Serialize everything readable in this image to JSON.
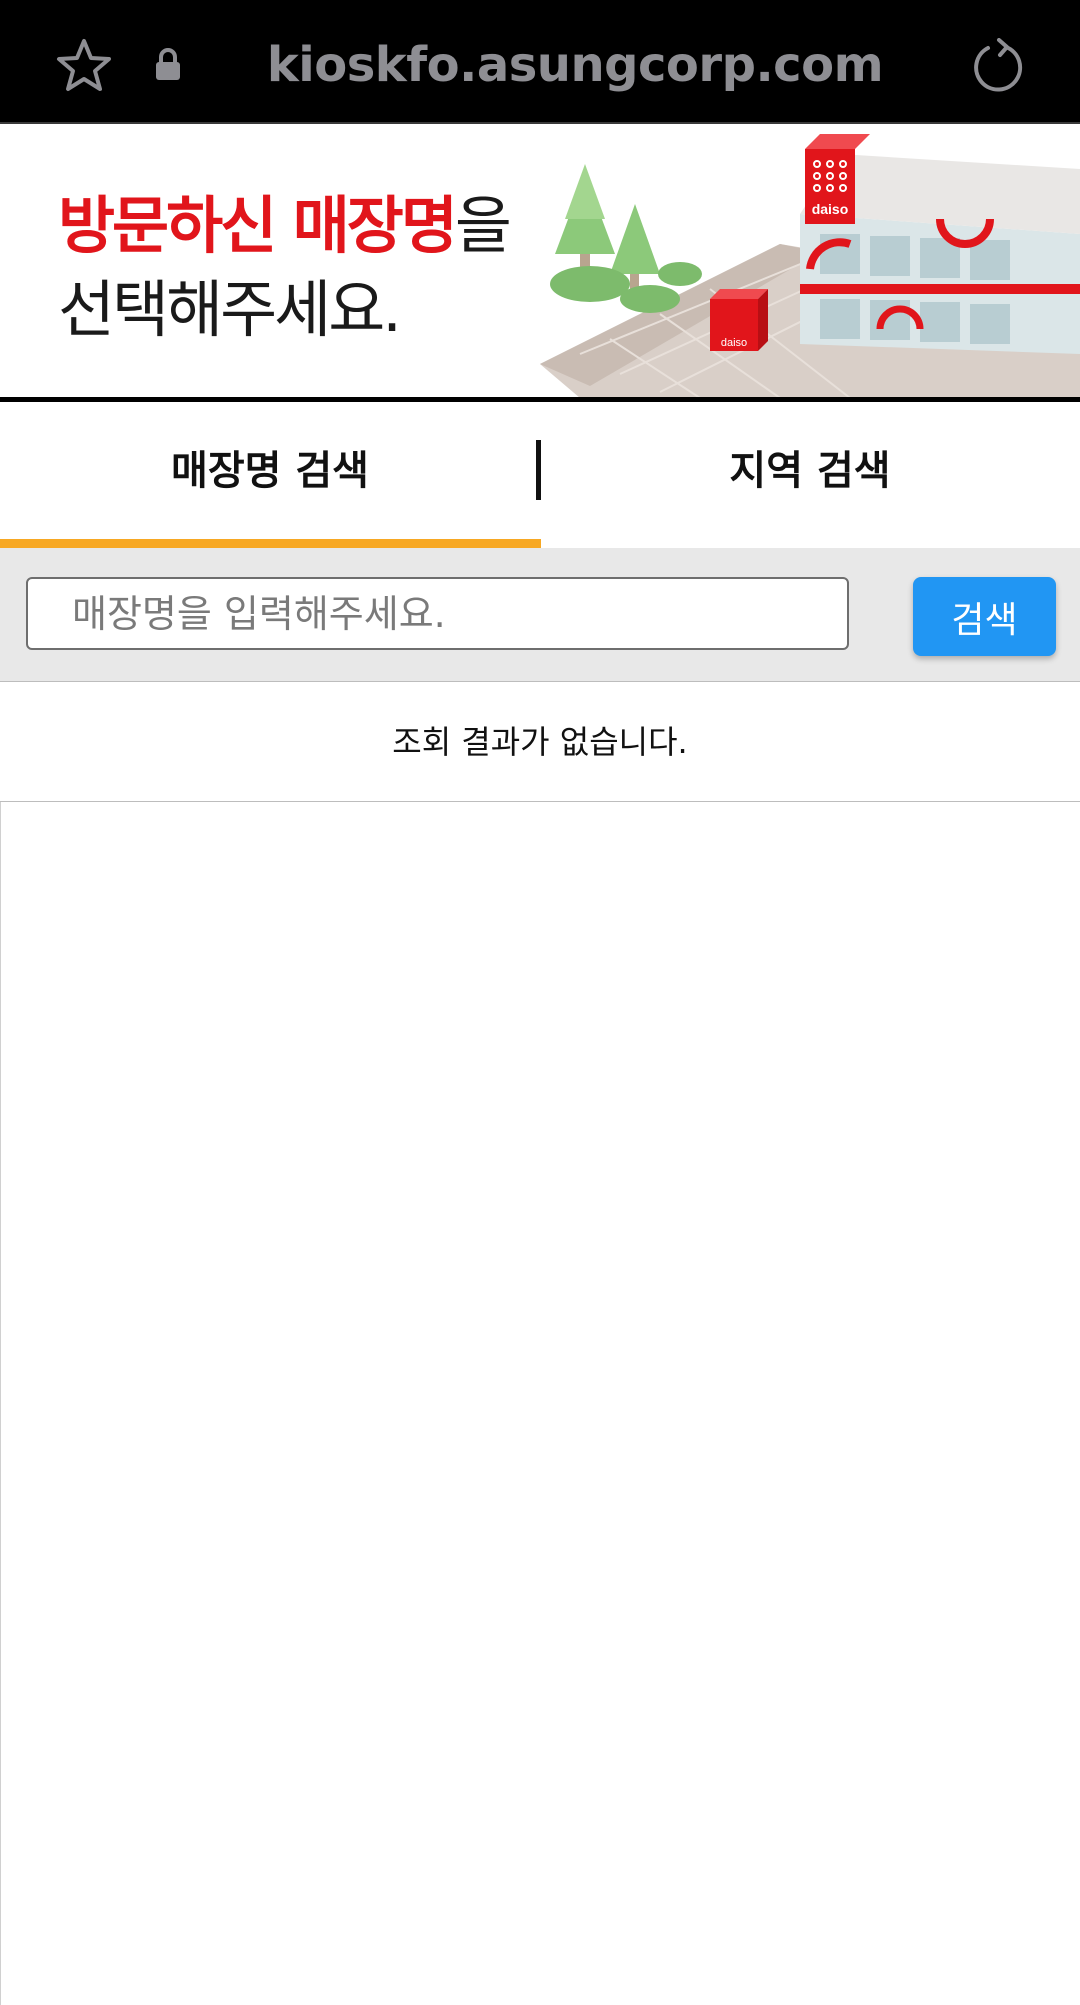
{
  "browser": {
    "url": "kioskfo.asungcorp.com",
    "icons": [
      "star-icon",
      "lock-icon",
      "reload-icon"
    ]
  },
  "banner": {
    "line1_red": "방문하신 매장명",
    "line1_suffix": "을",
    "line2": "선택해주세요.",
    "store_sign": "daiso",
    "accent_color": "#e1151b"
  },
  "tabs": [
    {
      "label": "매장명 검색",
      "active": true
    },
    {
      "label": "지역 검색",
      "active": false
    }
  ],
  "search": {
    "placeholder": "매장명을 입력해주세요.",
    "value": "",
    "button_label": "검색",
    "button_color": "#2196f3"
  },
  "results": {
    "empty_message": "조회 결과가 없습니다."
  },
  "colors": {
    "tab_indicator": "#f7a823"
  }
}
